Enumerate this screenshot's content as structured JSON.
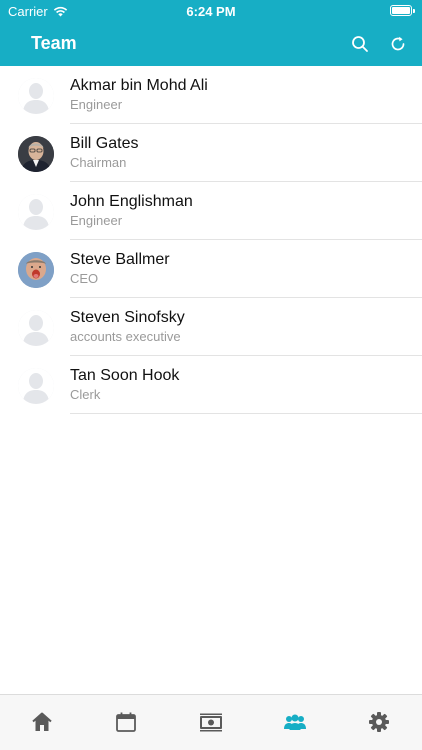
{
  "status_bar": {
    "carrier": "Carrier",
    "time": "6:24 PM"
  },
  "nav": {
    "title": "Team",
    "search_icon": "search-icon",
    "refresh_icon": "refresh-icon"
  },
  "members": [
    {
      "name": "Akmar bin Mohd Ali",
      "role": "Engineer",
      "avatar": "placeholder"
    },
    {
      "name": "Bill Gates",
      "role": "Chairman",
      "avatar": "photo"
    },
    {
      "name": "John Englishman",
      "role": "Engineer",
      "avatar": "placeholder"
    },
    {
      "name": "Steve Ballmer",
      "role": "CEO",
      "avatar": "photo"
    },
    {
      "name": "Steven Sinofsky",
      "role": "accounts executive",
      "avatar": "placeholder"
    },
    {
      "name": "Tan Soon Hook",
      "role": "Clerk",
      "avatar": "placeholder"
    }
  ],
  "tabs": [
    {
      "icon": "home-icon",
      "active": false
    },
    {
      "icon": "calendar-icon",
      "active": false
    },
    {
      "icon": "money-icon",
      "active": false
    },
    {
      "icon": "team-icon",
      "active": true
    },
    {
      "icon": "settings-icon",
      "active": false
    }
  ],
  "colors": {
    "accent": "#17aec5",
    "tab_inactive": "#5a5a5a",
    "placeholder_avatar": "#e6e8ec"
  }
}
